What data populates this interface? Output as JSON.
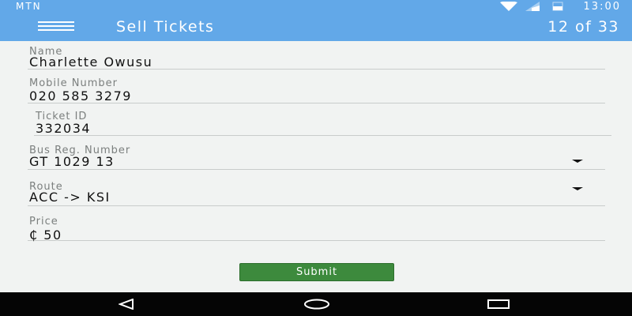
{
  "status_bar": {
    "carrier": "MTN",
    "time": "13:00"
  },
  "app_bar": {
    "title": "Sell Tickets",
    "counter": "12 of 33"
  },
  "form": {
    "name": {
      "label": "Name",
      "value": "Charlette Owusu"
    },
    "mobile": {
      "label": "Mobile Number",
      "value": "020 585 3279"
    },
    "ticket_id": {
      "label": "Ticket ID",
      "value": "332034"
    },
    "bus_reg": {
      "label": "Bus Reg. Number",
      "value": "GT 1029 13"
    },
    "route": {
      "label": "Route",
      "value": "ACC -> KSI"
    },
    "price": {
      "label": "Price",
      "value": "₵ 50"
    }
  },
  "submit_label": "Submit",
  "icons": {
    "menu": "hamburger-menu-icon",
    "wifi": "wifi-icon",
    "signal": "signal-icon",
    "battery": "battery-icon",
    "dropdown": "dropdown-arrow-icon",
    "back": "back-triangle-icon",
    "home": "home-circle-icon",
    "recents": "recents-square-icon"
  },
  "colors": {
    "primary": "#62a8e8",
    "background": "#f1f3f2",
    "submit": "#3d8a3d",
    "nav_bar": "#050505"
  }
}
